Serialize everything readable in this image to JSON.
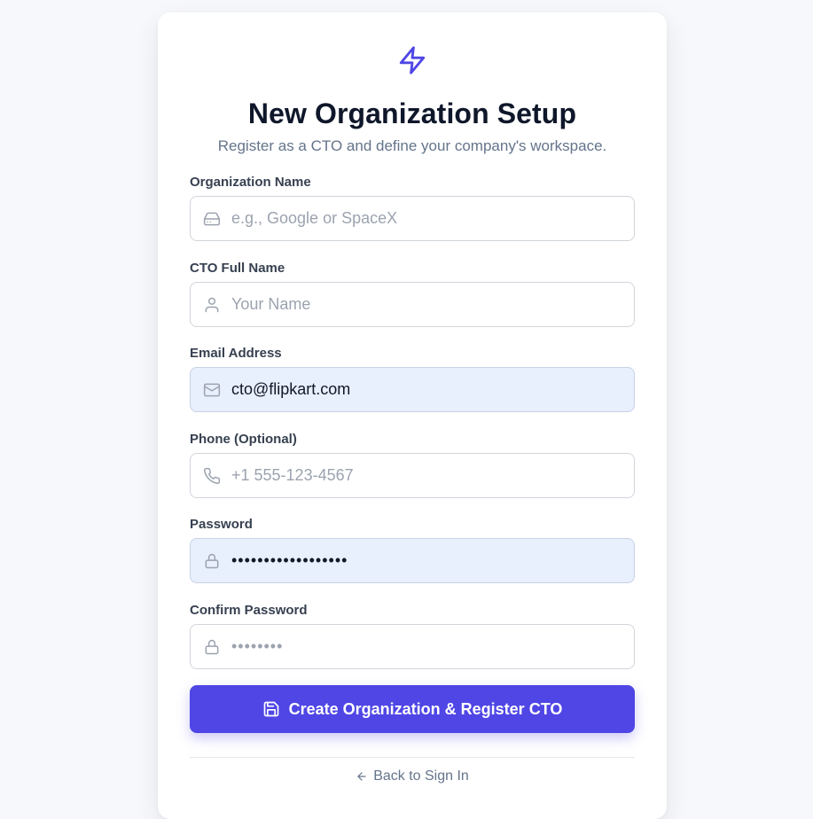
{
  "header": {
    "logo_icon": "zap-icon",
    "title": "New Organization Setup",
    "subtitle": "Register as a CTO and define your company's workspace."
  },
  "form": {
    "org_name": {
      "label": "Organization Name",
      "icon": "building-icon",
      "value": "",
      "placeholder": "e.g., Google or SpaceX"
    },
    "cto_name": {
      "label": "CTO Full Name",
      "icon": "user-icon",
      "value": "",
      "placeholder": "Your Name"
    },
    "email": {
      "label": "Email Address",
      "icon": "mail-icon",
      "value": "cto@flipkart.com",
      "placeholder": ""
    },
    "phone": {
      "label": "Phone (Optional)",
      "icon": "phone-icon",
      "value": "",
      "placeholder": "+1 555-123-4567"
    },
    "password": {
      "label": "Password",
      "icon": "lock-icon",
      "value": "••••••••••••••••••",
      "placeholder": ""
    },
    "confirm_password": {
      "label": "Confirm Password",
      "icon": "lock-icon",
      "value": "",
      "placeholder": "••••••••"
    }
  },
  "actions": {
    "submit_icon": "save-icon",
    "submit_label": "Create Organization & Register CTO",
    "back_icon": "arrow-left-icon",
    "back_label": "Back to Sign In"
  },
  "colors": {
    "accent": "#4f46e5",
    "autofill_bg": "#e8effd",
    "page_bg": "#f7f8fb"
  }
}
